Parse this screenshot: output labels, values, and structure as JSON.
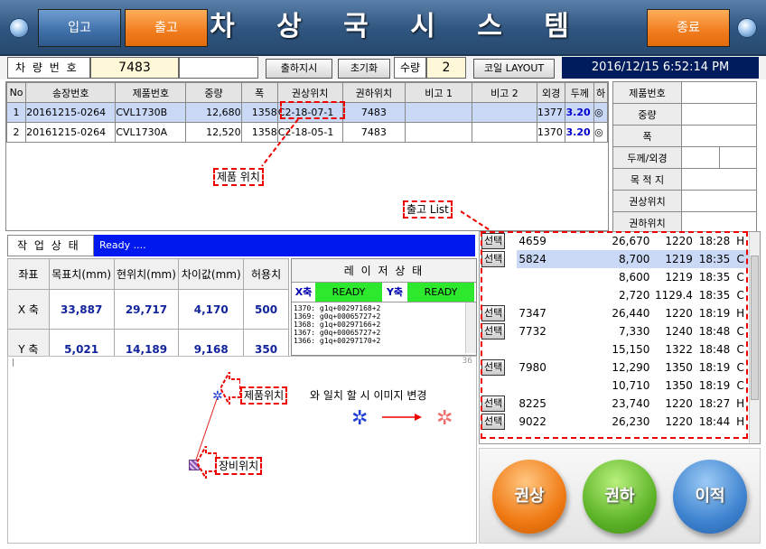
{
  "header": {
    "title": "차 상 국 시 스 템",
    "btn_in": "입고",
    "btn_out": "출고",
    "btn_exit": "종료"
  },
  "toolbar": {
    "vehicle_label": "차 량 번 호",
    "vehicle_value": "7483",
    "dispatch": "출하지시",
    "reset": "초기화",
    "qty_label": "수량",
    "qty_value": "2",
    "coil_layout": "코일 LAYOUT",
    "datetime": "2016/12/15  6:52:14 PM"
  },
  "grid": {
    "headers": [
      "No",
      "송장번호",
      "제품번호",
      "중량",
      "폭",
      "권상위치",
      "권하위치",
      "비고 1",
      "비고 2",
      "외경",
      "두께",
      "하"
    ],
    "rows": [
      [
        "1",
        "20161215-0264",
        "CVL1730B",
        "12,680",
        "1358",
        "C2-18-07-1",
        "7483",
        "",
        "",
        "1377",
        "3.20",
        "◎"
      ],
      [
        "2",
        "20161215-0264",
        "CVL1730A",
        "12,520",
        "1358",
        "C2-18-05-1",
        "7483",
        "",
        "",
        "1370",
        "3.20",
        "◎"
      ]
    ]
  },
  "side": {
    "labels": [
      "제품번호",
      "중량",
      "폭",
      "두께/외경",
      "목 적 지",
      "권상위치",
      "권하위치"
    ]
  },
  "status": {
    "label": "작 업 상 태",
    "value": "Ready ...."
  },
  "coord": {
    "headers": [
      "좌표",
      "목표치(mm)",
      "현위치(mm)",
      "차이값(mm)",
      "허용치"
    ],
    "rows": [
      [
        "X 축",
        "33,887",
        "29,717",
        "4,170",
        "500"
      ],
      [
        "Y 축",
        "5,021",
        "14,189",
        "9,168",
        "350"
      ]
    ]
  },
  "laser": {
    "title": "레 이 저 상 태",
    "x_label": "X축",
    "x_status": "READY",
    "y_label": "Y축",
    "y_status": "READY",
    "log": [
      "1370: g1q+00297168+2",
      "1369: g0q+00065727+2",
      "1368: g1q+00297166+2",
      "1367: g0q+00065727+2",
      "1366: g1q+00297170+2"
    ]
  },
  "map": {
    "corner": "36",
    "legend_text": "와 일치 할 시 이미지 변경"
  },
  "annot": {
    "product_pos": "제품 위치",
    "release_list": "출고 List",
    "product_pos2": "제품위치",
    "equip_pos": "장비위치"
  },
  "out_list": {
    "select_label": "선택",
    "rows": [
      {
        "btn": true,
        "id": "4659",
        "w": "26,670",
        "a": "1220",
        "t": "18:28",
        "c": "H"
      },
      {
        "btn": true,
        "id": "5824",
        "w": "8,700",
        "a": "1219",
        "t": "18:35",
        "c": "C",
        "sel": true
      },
      {
        "btn": false,
        "id": "",
        "w": "8,600",
        "a": "1219",
        "t": "18:35",
        "c": "C"
      },
      {
        "btn": false,
        "id": "",
        "w": "2,720",
        "a": "1129.4",
        "t": "18:35",
        "c": "C"
      },
      {
        "btn": true,
        "id": "7347",
        "w": "26,440",
        "a": "1220",
        "t": "18:19",
        "c": "H"
      },
      {
        "btn": true,
        "id": "7732",
        "w": "7,330",
        "a": "1240",
        "t": "18:48",
        "c": "C"
      },
      {
        "btn": false,
        "id": "",
        "w": "15,150",
        "a": "1322",
        "t": "18:48",
        "c": "C"
      },
      {
        "btn": true,
        "id": "7980",
        "w": "12,290",
        "a": "1350",
        "t": "18:19",
        "c": "C"
      },
      {
        "btn": false,
        "id": "",
        "w": "10,710",
        "a": "1350",
        "t": "18:19",
        "c": "C"
      },
      {
        "btn": true,
        "id": "8225",
        "w": "23,740",
        "a": "1220",
        "t": "18:27",
        "c": "H"
      },
      {
        "btn": true,
        "id": "9022",
        "w": "26,230",
        "a": "1220",
        "t": "18:44",
        "c": "H"
      }
    ]
  },
  "actions": {
    "up": "권상",
    "down": "권하",
    "move": "이적"
  }
}
